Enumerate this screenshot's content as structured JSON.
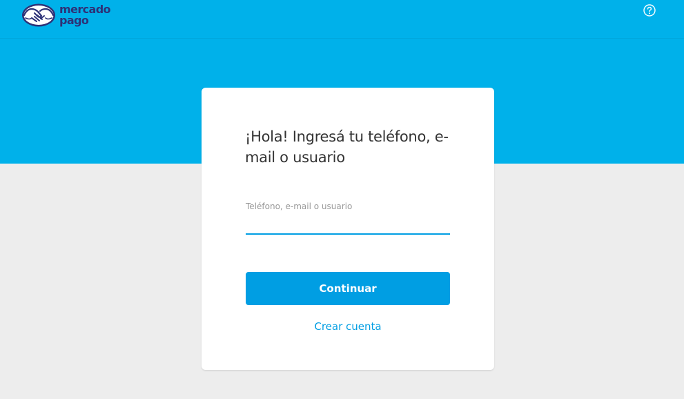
{
  "brand": {
    "line1": "mercado",
    "line2": "pago",
    "colors": {
      "primary_blue": "#009ee3",
      "header_blue": "#00b1ea",
      "logo_navy": "#2d3277",
      "background_gray": "#ededed"
    }
  },
  "header": {
    "help_icon": "question-circle-icon"
  },
  "login": {
    "title": "¡Hola! Ingresá tu teléfono, e-mail o usuario",
    "field_label": "Teléfono, e-mail o usuario",
    "field_value": "",
    "continue_label": "Continuar",
    "create_account_label": "Crear cuenta"
  }
}
